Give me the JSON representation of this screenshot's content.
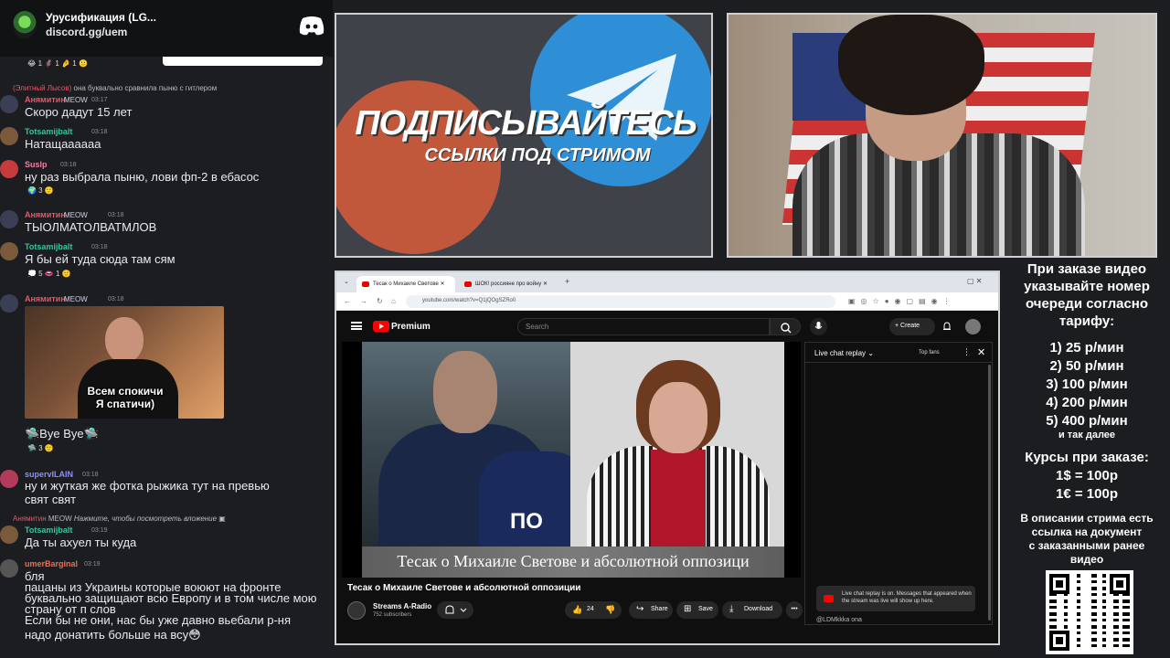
{
  "discord": {
    "server_name": "Урусификация (LG...",
    "invite": "discord.gg/uem"
  },
  "chat": [
    {
      "reactions_top": "😂 1   🦸 1   🤌 1   🙂"
    },
    {
      "reply_name": "(Элитный Лысов)",
      "reply_text": "она буквально сравнила пыню с гитлером",
      "name": "Анямитин",
      "badge": "MEOW",
      "time": "03:17",
      "text": "Скоро дадут 15 лет",
      "color": "#e8576a"
    },
    {
      "name": "Totsamijbalt",
      "time": "03:18",
      "text": "Натащаааааа",
      "color": "#37c49a"
    },
    {
      "name": "Suslp",
      "time": "03:18",
      "text": "ну раз выбрала пыню, лови фп-2 в ебасос",
      "reactions": "🌍 3   🙂",
      "color": "#f47fa0"
    },
    {
      "name": "Анямитин",
      "badge": "MEOW",
      "time": "03:18",
      "text": "ТЫОЛМАТОЛВАТМЛОВ",
      "color": "#e8576a"
    },
    {
      "name": "Totsamijbalt",
      "time": "03:18",
      "text": "Я бы ей туда сюда там сям",
      "reactions": "💭 5   👄 1   🙂",
      "color": "#37c49a"
    },
    {
      "name": "Анямитин",
      "badge": "MEOW",
      "time": "03:18",
      "image_caption": "Всем спокичи\nЯ спатичи)",
      "text": "🛸Bye Bye🛸",
      "reactions": "🛸 3   🙂",
      "color": "#e8576a"
    },
    {
      "name": "supervILAIN",
      "time": "03:18",
      "text": "ну и жуткая же фотка рыжика тут на превью",
      "text2": "свят свят",
      "color": "#8f8ff7"
    },
    {
      "reply_name": "Анямитин",
      "reply_badge": "MEOW",
      "reply_text": "Нажмите, чтобы посмотреть вложение",
      "name": "Totsamijbalt",
      "time": "03:19",
      "text": "Да ты ахуел ты куда",
      "color": "#37c49a"
    },
    {
      "name": "umerBarginal",
      "time": "03:19",
      "text": "бля",
      "text2": "пацаны из Украины которые воюют на фронте",
      "text3": "буквально защищают всю Европу и в том числе мою",
      "text4": "страну от п слов",
      "text5": "Если бы не они, нас бы уже давно вьебали р-ня",
      "text6": "надо донатить больше на всу😳",
      "color": "#f06d4f"
    }
  ],
  "promo": {
    "line1": "ПОДПИСЫВАЙТЕСЬ",
    "line2": "ССЫЛКИ ПОД СТРИМОМ"
  },
  "browser": {
    "tab1": "Тесак о Михаиле Светове",
    "tab2": "ШОК! россияне про войну",
    "url": "youtube.com/watch?v=Q1jQOgSZRo0",
    "brand": "Premium",
    "search_placeholder": "Search",
    "create": "+ Create",
    "video_caption": "Тесак о Михаиле Светове и абсолютной оппозици",
    "police": "ПО",
    "title": "Тесак о Михаиле Светове и абсолютной оппозиции",
    "channel": "Streams A-Radio",
    "subs": "752 subscribers",
    "likes": "24",
    "share": "Share",
    "save": "Save",
    "download": "Download",
    "more": "•••",
    "live_chat": "Live chat replay ⌄",
    "top_fans": "Top fans",
    "close": "✕",
    "notice": "Live chat replay is on. Messages that appeared when the stream was live will show up here.",
    "chat_user": "@LDMkkka  ona"
  },
  "info": {
    "l1": "При заказе видео",
    "l2": "указывайте номер",
    "l3": "очереди согласно",
    "l4": "тарифу:",
    "t1": "1) 25 р/мин",
    "t2": "2) 50 р/мин",
    "t3": "3) 100 р/мин",
    "t4": "4) 200 р/мин",
    "t5": "5) 400 р/мин",
    "etc": "и так далее",
    "c1": "Курсы при заказе:",
    "c2": "1$ = 100р",
    "c3": "1€ = 100р",
    "d1": "В описании стрима есть",
    "d2": "ссылка на документ",
    "d3": "с заказанными ранее",
    "d4": "видео"
  }
}
